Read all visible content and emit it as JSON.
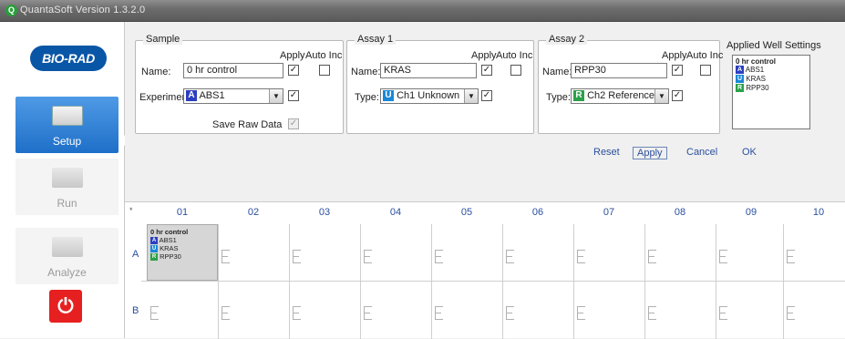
{
  "window": {
    "title": "QuantaSoft Version 1.3.2.0"
  },
  "sidebar": {
    "logo": "BIO-RAD",
    "nav": [
      {
        "label": "Setup",
        "active": true
      },
      {
        "label": "Run",
        "active": false
      },
      {
        "label": "Analyze",
        "active": false
      }
    ],
    "power_icon": "power-icon"
  },
  "sample": {
    "legend": "Sample",
    "apply_label": "Apply",
    "autoinc_label": "Auto Inc",
    "name_label": "Name:",
    "name_value": "0 hr control",
    "name_apply": true,
    "name_autoinc": false,
    "experiment_label": "Experiment:",
    "experiment_value": "ABS1",
    "experiment_badge": "A",
    "experiment_apply": true,
    "save_raw_label": "Save Raw Data",
    "save_raw_checked": true
  },
  "assay1": {
    "legend": "Assay 1",
    "apply_label": "Apply",
    "autoinc_label": "Auto Inc",
    "name_label": "Name:",
    "name_value": "KRAS",
    "name_apply": true,
    "name_autoinc": false,
    "type_label": "Type:",
    "type_value": "Ch1 Unknown",
    "type_badge": "U",
    "type_apply": true
  },
  "assay2": {
    "legend": "Assay 2",
    "apply_label": "Apply",
    "autoinc_label": "Auto Inc",
    "name_label": "Name:",
    "name_value": "RPP30",
    "name_apply": true,
    "name_autoinc": false,
    "type_label": "Type:",
    "type_value": "Ch2 Reference",
    "type_badge": "R",
    "type_apply": true
  },
  "applied_settings": {
    "label": "Applied Well Settings",
    "sample": "0 hr control",
    "rows": [
      {
        "badge": "A",
        "text": "ABS1"
      },
      {
        "badge": "U",
        "text": "KRAS"
      },
      {
        "badge": "R",
        "text": "RPP30"
      }
    ]
  },
  "actions": {
    "reset": "Reset",
    "apply": "Apply",
    "cancel": "Cancel",
    "ok": "OK"
  },
  "plate": {
    "corner": "*",
    "columns": [
      "01",
      "02",
      "03",
      "04",
      "05",
      "06",
      "07",
      "08",
      "09",
      "10"
    ],
    "rows": [
      "A",
      "B"
    ],
    "selected_well": {
      "sample": "0 hr control",
      "lines": [
        {
          "badge": "A",
          "text": "ABS1"
        },
        {
          "badge": "U",
          "text": "KRAS"
        },
        {
          "badge": "R",
          "text": "RPP30"
        }
      ]
    }
  },
  "colors": {
    "accent": "#1e6fc8",
    "brand": "#0a56a6",
    "power": "#e62020"
  }
}
